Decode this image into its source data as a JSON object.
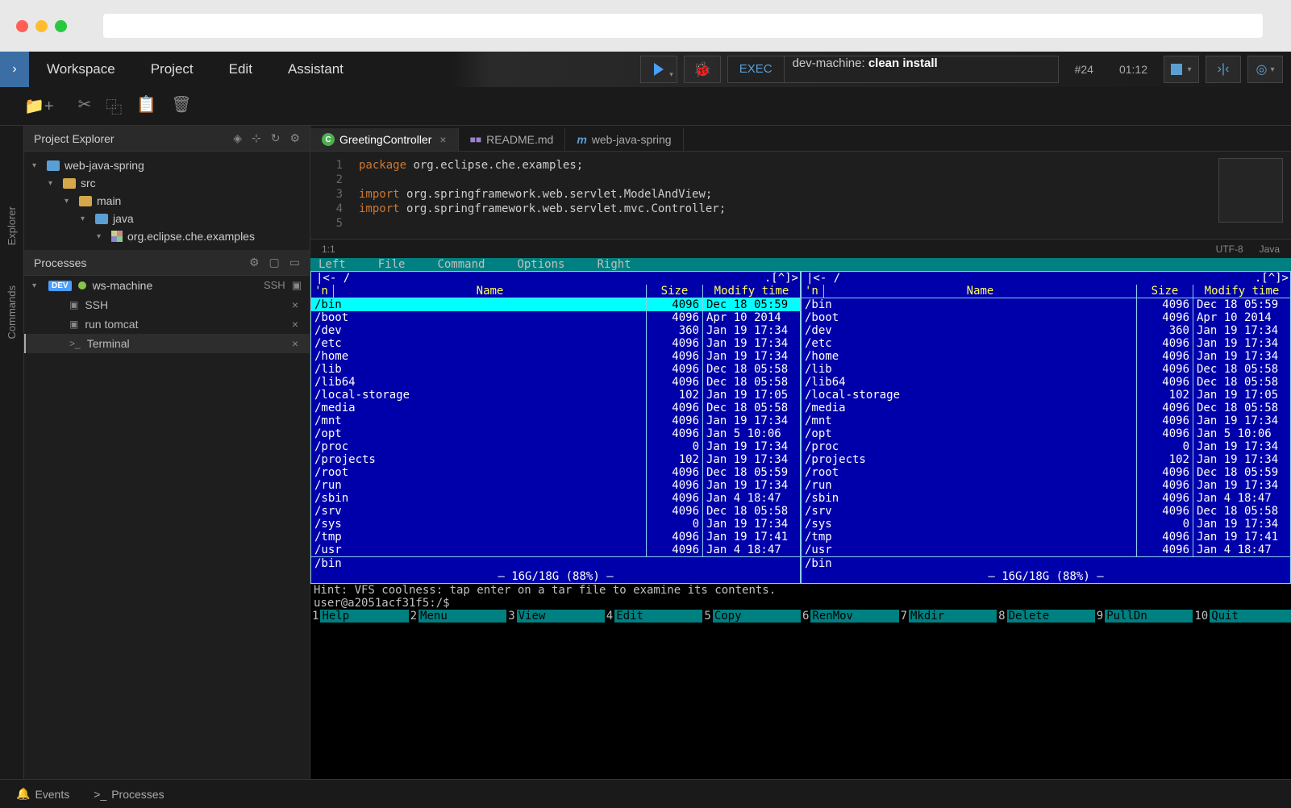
{
  "menu": {
    "items": [
      "Workspace",
      "Project",
      "Edit",
      "Assistant"
    ],
    "exec_label": "EXEC",
    "exec_command_prefix": "dev-machine: ",
    "exec_command_main": "clean install",
    "run_number": "#24",
    "run_time": "01:12"
  },
  "panels": {
    "explorer_title": "Project Explorer",
    "rail": {
      "explorer": "Explorer",
      "commands": "Commands"
    },
    "tree": {
      "root": "web-java-spring",
      "src": "src",
      "main": "main",
      "java": "java",
      "pkg": "org.eclipse.che.examples"
    },
    "processes_title": "Processes",
    "machine": "ws-machine",
    "ssh_label": "SSH",
    "proc_ssh": "SSH",
    "proc_tomcat": "run tomcat",
    "proc_terminal": "Terminal"
  },
  "tabs": {
    "t1": "GreetingController",
    "t2": "README.md",
    "t3": "web-java-spring"
  },
  "code": {
    "l1": "package org.eclipse.che.examples;",
    "l3": "import org.springframework.web.servlet.ModelAndView;",
    "l4": "import org.springframework.web.servlet.mvc.Controller;"
  },
  "status": {
    "pos": "1:1",
    "encoding": "UTF-8",
    "lang": "Java"
  },
  "mc": {
    "menu": [
      "Left",
      "File",
      "Command",
      "Options",
      "Right"
    ],
    "headers": {
      "mark": "'n",
      "name": "Name",
      "size": "Size",
      "modify": "Modify time"
    },
    "path_left": "/",
    "path_right": "/",
    "path_corner": ".[^]>",
    "rows": [
      {
        "name": "/bin",
        "size": "4096",
        "mod": "Dec 18 05:59",
        "selected": true
      },
      {
        "name": "/boot",
        "size": "4096",
        "mod": "Apr 10  2014"
      },
      {
        "name": "/dev",
        "size": "360",
        "mod": "Jan 19 17:34"
      },
      {
        "name": "/etc",
        "size": "4096",
        "mod": "Jan 19 17:34"
      },
      {
        "name": "/home",
        "size": "4096",
        "mod": "Jan 19 17:34"
      },
      {
        "name": "/lib",
        "size": "4096",
        "mod": "Dec 18 05:58"
      },
      {
        "name": "/lib64",
        "size": "4096",
        "mod": "Dec 18 05:58"
      },
      {
        "name": "/local-storage",
        "size": "102",
        "mod": "Jan 19 17:05"
      },
      {
        "name": "/media",
        "size": "4096",
        "mod": "Dec 18 05:58"
      },
      {
        "name": "/mnt",
        "size": "4096",
        "mod": "Jan 19 17:34"
      },
      {
        "name": "/opt",
        "size": "4096",
        "mod": "Jan  5 10:06"
      },
      {
        "name": "/proc",
        "size": "0",
        "mod": "Jan 19 17:34"
      },
      {
        "name": "/projects",
        "size": "102",
        "mod": "Jan 19 17:34"
      },
      {
        "name": "/root",
        "size": "4096",
        "mod": "Dec 18 05:59"
      },
      {
        "name": "/run",
        "size": "4096",
        "mod": "Jan 19 17:34"
      },
      {
        "name": "/sbin",
        "size": "4096",
        "mod": "Jan  4 18:47"
      },
      {
        "name": "/srv",
        "size": "4096",
        "mod": "Dec 18 05:58"
      },
      {
        "name": "/sys",
        "size": "0",
        "mod": "Jan 19 17:34"
      },
      {
        "name": "/tmp",
        "size": "4096",
        "mod": "Jan 19 17:41"
      },
      {
        "name": "/usr",
        "size": "4096",
        "mod": "Jan  4 18:47"
      }
    ],
    "footer_selected": "/bin",
    "disk_usage": "16G/18G (88%)",
    "hint": "Hint: VFS coolness: tap enter on a tar file to examine its contents.",
    "prompt": "user@a2051acf31f5:/$",
    "fkeys": [
      {
        "n": "1",
        "l": "Help"
      },
      {
        "n": "2",
        "l": "Menu"
      },
      {
        "n": "3",
        "l": "View"
      },
      {
        "n": "4",
        "l": "Edit"
      },
      {
        "n": "5",
        "l": "Copy"
      },
      {
        "n": "6",
        "l": "RenMov"
      },
      {
        "n": "7",
        "l": "Mkdir"
      },
      {
        "n": "8",
        "l": "Delete"
      },
      {
        "n": "9",
        "l": "PullDn"
      },
      {
        "n": "10",
        "l": "Quit"
      }
    ]
  },
  "bottom": {
    "events": "Events",
    "processes": "Processes"
  }
}
